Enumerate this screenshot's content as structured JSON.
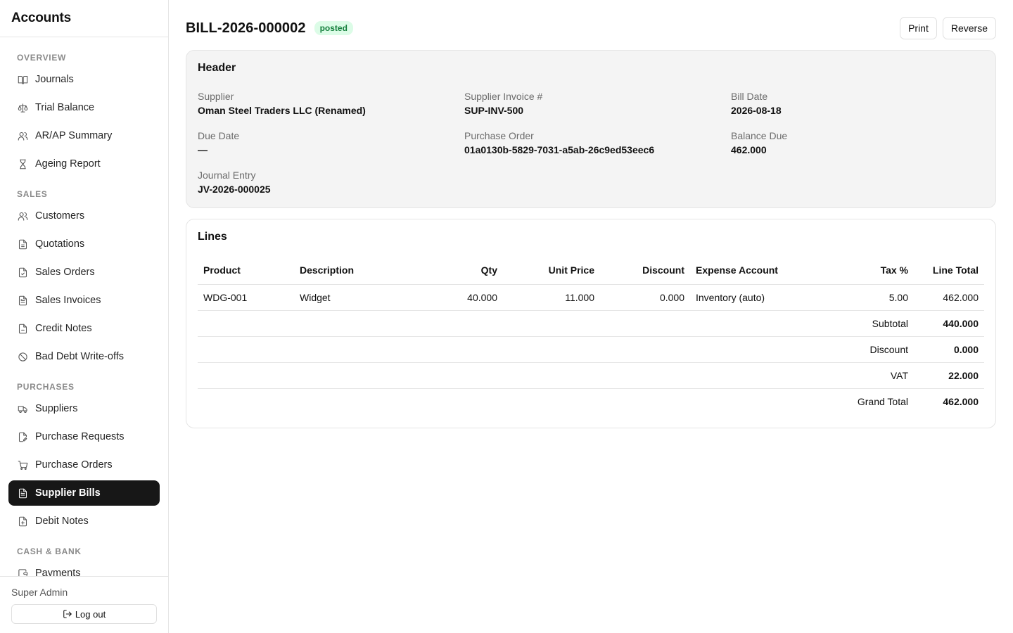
{
  "sidebar": {
    "brand": "Accounts",
    "sections": [
      {
        "label": "OVERVIEW",
        "items": [
          {
            "label": "Journals",
            "icon": "book-icon"
          },
          {
            "label": "Trial Balance",
            "icon": "scale-icon"
          },
          {
            "label": "AR/AP Summary",
            "icon": "users-icon"
          },
          {
            "label": "Ageing Report",
            "icon": "hourglass-icon"
          }
        ]
      },
      {
        "label": "SALES",
        "items": [
          {
            "label": "Customers",
            "icon": "users-icon"
          },
          {
            "label": "Quotations",
            "icon": "file-text-icon"
          },
          {
            "label": "Sales Orders",
            "icon": "file-check-icon"
          },
          {
            "label": "Sales Invoices",
            "icon": "file-lines-icon"
          },
          {
            "label": "Credit Notes",
            "icon": "file-minus-icon"
          },
          {
            "label": "Bad Debt Write-offs",
            "icon": "ban-icon"
          }
        ]
      },
      {
        "label": "PURCHASES",
        "items": [
          {
            "label": "Suppliers",
            "icon": "truck-icon"
          },
          {
            "label": "Purchase Requests",
            "icon": "file-pen-icon"
          },
          {
            "label": "Purchase Orders",
            "icon": "cart-icon"
          },
          {
            "label": "Supplier Bills",
            "icon": "file-lines-icon",
            "active": true
          },
          {
            "label": "Debit Notes",
            "icon": "file-plus-icon"
          }
        ]
      },
      {
        "label": "CASH & BANK",
        "items": [
          {
            "label": "Payments",
            "icon": "wallet-icon"
          }
        ]
      }
    ],
    "user": "Super Admin",
    "logout_label": "Log out"
  },
  "page": {
    "title": "BILL-2026-000002",
    "status": "posted",
    "actions": {
      "print": "Print",
      "reverse": "Reverse"
    }
  },
  "header_card": {
    "title": "Header",
    "fields": [
      {
        "label": "Supplier",
        "value": "Oman Steel Traders LLC (Renamed)"
      },
      {
        "label": "Supplier Invoice #",
        "value": "SUP-INV-500"
      },
      {
        "label": "Bill Date",
        "value": "2026-08-18"
      },
      {
        "label": "Due Date",
        "value": "—"
      },
      {
        "label": "Purchase Order",
        "value": "01a0130b-5829-7031-a5ab-26c9ed53eec6"
      },
      {
        "label": "Balance Due",
        "value": "462.000"
      },
      {
        "label": "Journal Entry",
        "value": "JV-2026-000025"
      }
    ]
  },
  "lines_card": {
    "title": "Lines",
    "columns": [
      "Product",
      "Description",
      "Qty",
      "Unit Price",
      "Discount",
      "Expense Account",
      "Tax %",
      "Line Total"
    ],
    "rows": [
      [
        "WDG-001",
        "Widget",
        "40.000",
        "11.000",
        "0.000",
        "Inventory (auto)",
        "5.00",
        "462.000"
      ]
    ],
    "summary": [
      {
        "label": "Subtotal",
        "value": "440.000"
      },
      {
        "label": "Discount",
        "value": "0.000"
      },
      {
        "label": "VAT",
        "value": "22.000"
      },
      {
        "label": "Grand Total",
        "value": "462.000"
      }
    ]
  },
  "colors": {
    "active_nav_bg": "#171717",
    "badge_bg": "#dcfce7",
    "badge_text": "#15803d",
    "header_card_bg": "#f4f4f4"
  }
}
